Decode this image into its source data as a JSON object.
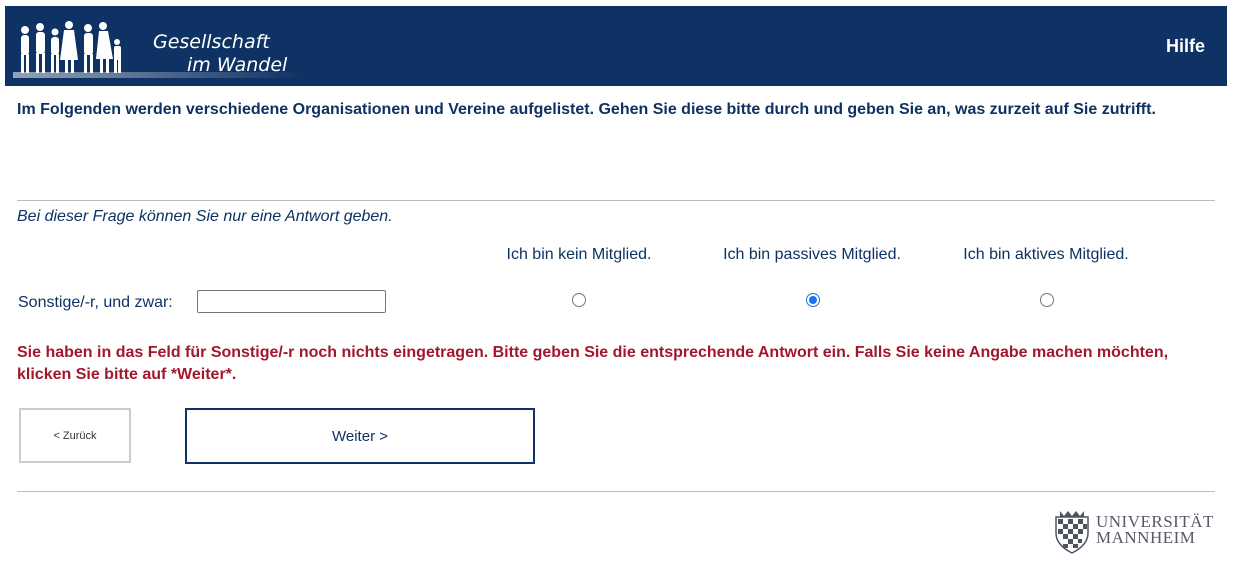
{
  "header": {
    "logo_line1": "Gesellschaft",
    "logo_line2": "im Wandel",
    "help_label": "Hilfe",
    "background": "#0e3263"
  },
  "question": {
    "intro": "Im Folgenden werden verschiedene Organisationen und Vereine aufgelistet. Gehen Sie diese bitte durch und geben Sie an, was zurzeit auf Sie zutrifft.",
    "hint": "Bei dieser Frage können Sie nur eine Antwort geben.",
    "columns": [
      {
        "label": "Ich bin kein Mitglied.",
        "selected": false
      },
      {
        "label": "Ich bin passives Mitglied.",
        "selected": true
      },
      {
        "label": "Ich bin aktives Mitglied.",
        "selected": false
      }
    ],
    "row_label": "Sonstige/-r, und zwar:",
    "other_value": "",
    "error": "Sie haben in das Feld für Sonstige/-r noch nichts eingetragen. Bitte geben Sie die entsprechende Antwort ein. Falls Sie keine Angabe machen möchten, klicken Sie bitte auf *Weiter*.",
    "error_color": "#a3172e"
  },
  "nav": {
    "back_label": "< Zurück",
    "next_label": "Weiter >"
  },
  "footer": {
    "uni_line1": "UNIVERSITÄT",
    "uni_line2": "MANNHEIM"
  }
}
